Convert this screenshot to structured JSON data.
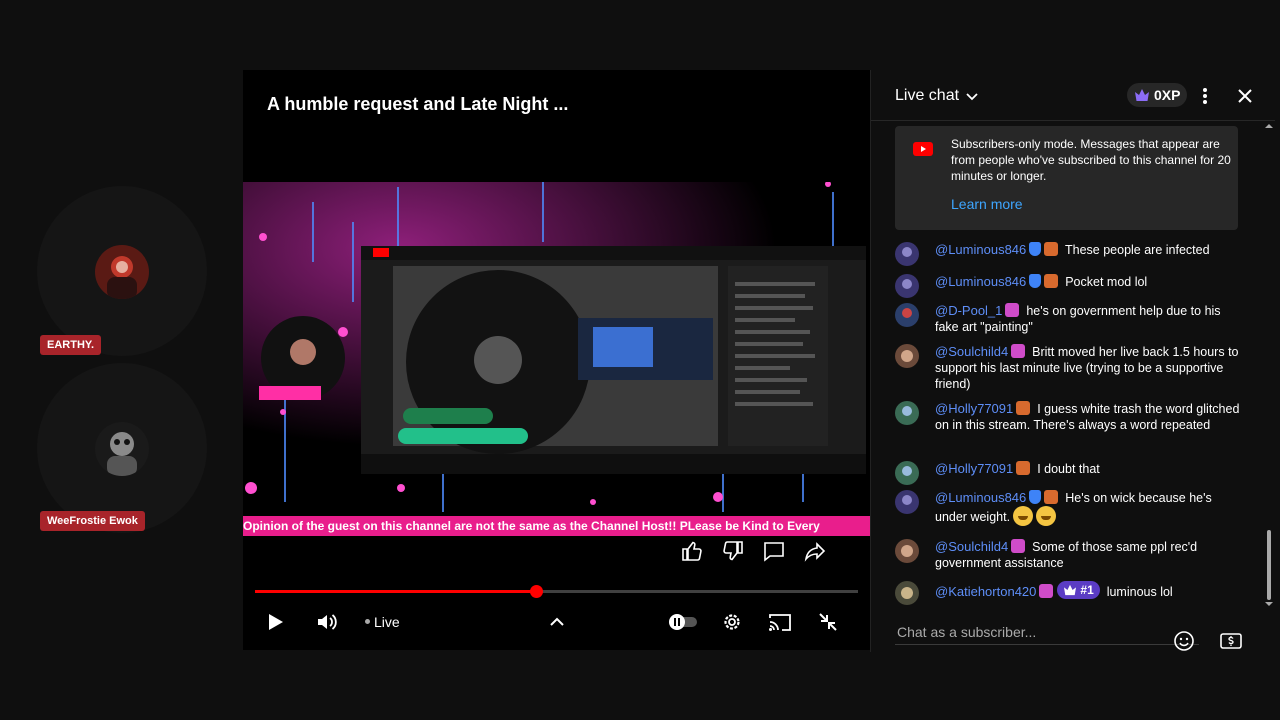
{
  "participants": [
    {
      "name": "EARTHY."
    },
    {
      "name": "WeeFrostie Ewok"
    }
  ],
  "video": {
    "title": "A humble request and Late Night ...",
    "ticker": "Opinion of the guest on this channel are not the same as the Channel Host!! PLease be Kind to Every",
    "progress_fraction": 0.466,
    "live_label": "Live",
    "icons": {
      "like": "thumb-up-icon",
      "dislike": "thumb-down-icon",
      "comment": "comment-icon",
      "share": "share-icon",
      "play": "play-icon",
      "volume": "volume-icon",
      "chapters": "chevron-up-icon",
      "autoplay": "autoplay-toggle-icon",
      "settings": "gear-icon",
      "cast": "cast-icon",
      "exit_fullscreen": "exit-fullscreen-icon"
    }
  },
  "chat": {
    "title": "Live chat",
    "xp": "0XP",
    "notice_text": "Subscribers-only mode. Messages that appear are from people who've subscribed to this channel for 20 minutes or longer.",
    "learn_more": "Learn more",
    "messages": [
      {
        "author": "@Luminous846",
        "text": "These people are infected"
      },
      {
        "author": "@Luminous846",
        "text": "Pocket mod lol"
      },
      {
        "author": "@D-Pool_1",
        "text": "he's on government help due to his fake art \"painting\""
      },
      {
        "author": "@Soulchild4",
        "text": "Britt moved her live back 1.5 hours to support his last minute live (trying to be a supportive friend)"
      },
      {
        "author": "@Holly77091",
        "text": "I guess white trash the word glitched on in this stream. There's always a word repeated"
      },
      {
        "author": "@Holly77091",
        "text": "I doubt that"
      },
      {
        "author": "@Luminous846",
        "text": "He's on wick because he's under weight."
      },
      {
        "author": "@Soulchild4",
        "text": "Some of those same ppl rec'd government assistance"
      },
      {
        "author": "@Katiehorton420",
        "rank": "#1",
        "text": "luminous lol"
      }
    ],
    "input_placeholder": "Chat as a subscriber...",
    "colors": {
      "author": "#5e8ef7",
      "link": "#3ea6ff",
      "progress": "#ff0000",
      "ticker": "#e91e8c"
    }
  }
}
